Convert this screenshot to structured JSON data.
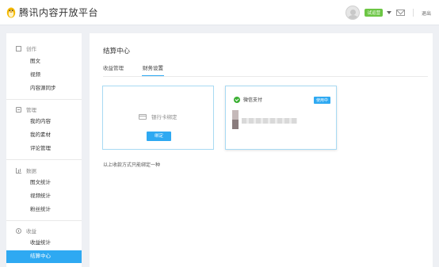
{
  "header": {
    "title": "腾讯内容开放平台",
    "badge": "试运营",
    "logout": "退出",
    "icons": {
      "logo": "penguin-logo-icon",
      "mail": "mail-icon",
      "caret": "chevron-down-icon"
    }
  },
  "sidebar": {
    "sections": [
      {
        "title": "创作",
        "icon": "edit-icon",
        "items": [
          "图文",
          "视频",
          "内容源同步"
        ]
      },
      {
        "title": "管理",
        "icon": "manage-icon",
        "items": [
          "我的内容",
          "我的素材",
          "评论管理"
        ]
      },
      {
        "title": "数据",
        "icon": "chart-icon",
        "items": [
          "图文统计",
          "视频统计",
          "粉丝统计"
        ]
      },
      {
        "title": "收益",
        "icon": "income-icon",
        "items": [
          "收益统计",
          "结算中心"
        ]
      }
    ],
    "active_item": "结算中心"
  },
  "main": {
    "title": "结算中心",
    "tabs": [
      "收益管理",
      "财务设置"
    ],
    "active_tab": "财务设置",
    "bank_card": {
      "label": "银行卡绑定",
      "button": "绑定"
    },
    "wechat_card": {
      "label": "微信支付",
      "status": "使用中"
    },
    "note": "以上收款方式只能绑定一种"
  },
  "colors": {
    "accent": "#2ea9f2",
    "wechat": "#3cb034",
    "badge": "#6cc644"
  }
}
